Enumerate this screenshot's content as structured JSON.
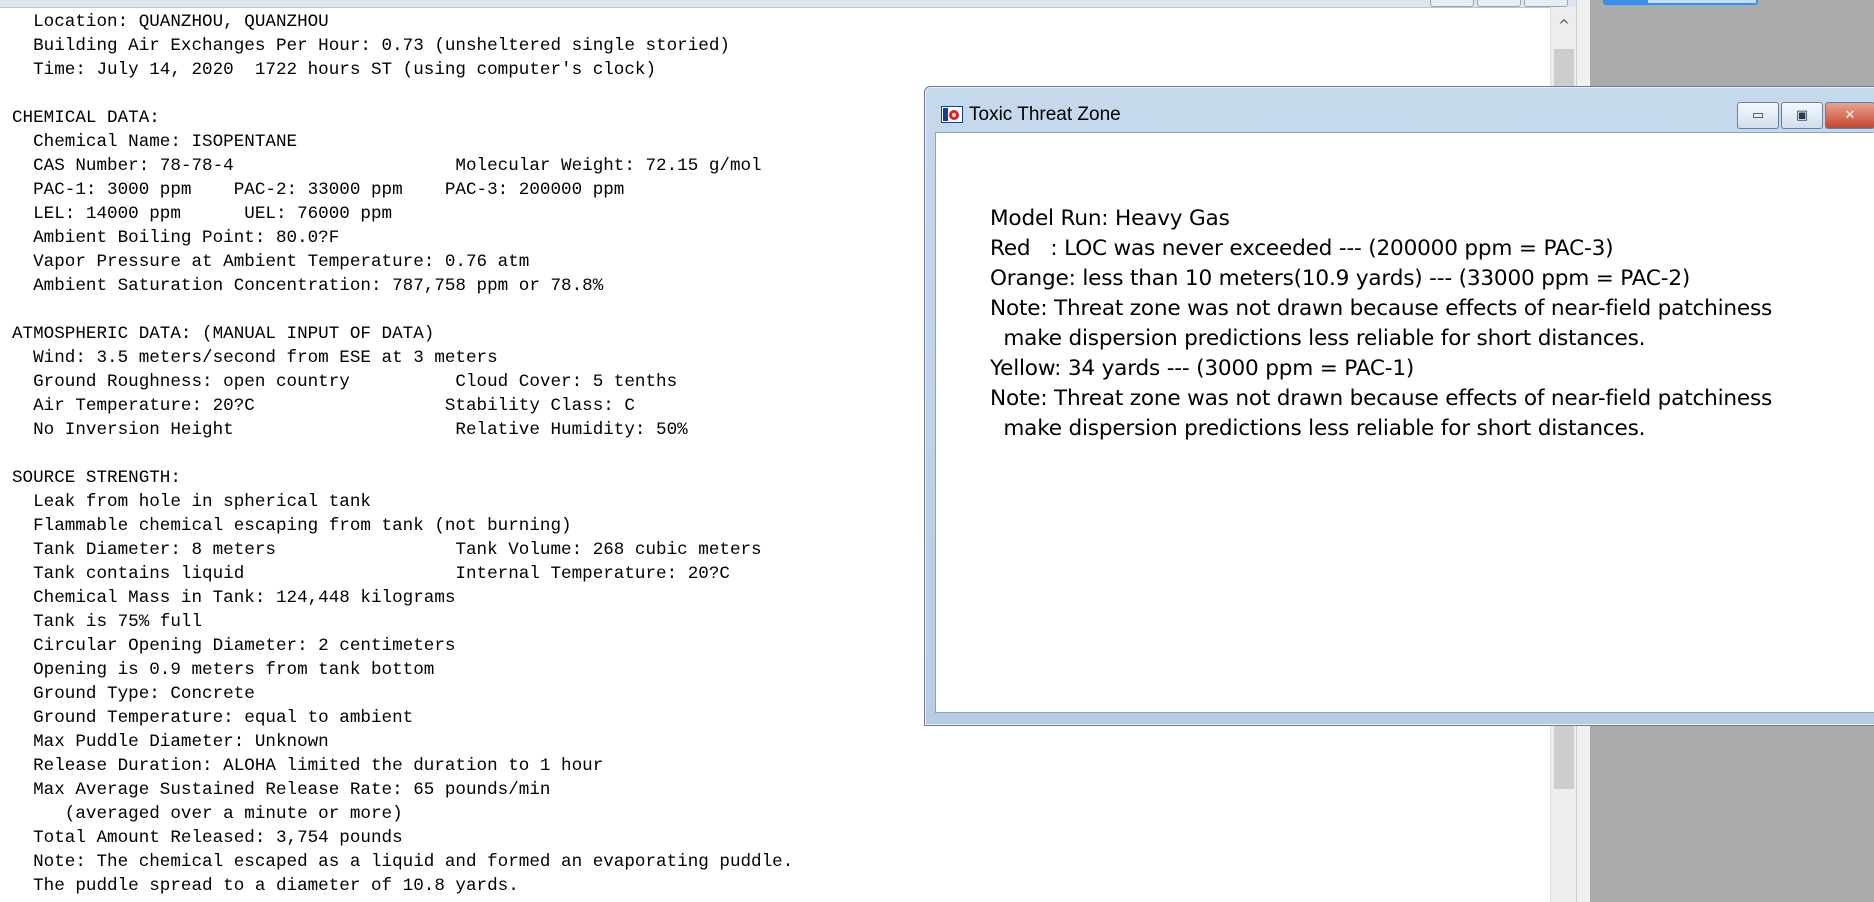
{
  "report": {
    "lines": [
      "  Location: QUANZHOU, QUANZHOU",
      "  Building Air Exchanges Per Hour: 0.73 (unsheltered single storied)",
      "  Time: July 14, 2020  1722 hours ST (using computer's clock)",
      "",
      "CHEMICAL DATA:",
      "  Chemical Name: ISOPENTANE",
      "  CAS Number: 78-78-4                     Molecular Weight: 72.15 g/mol",
      "  PAC-1: 3000 ppm    PAC-2: 33000 ppm    PAC-3: 200000 ppm",
      "  LEL: 14000 ppm      UEL: 76000 ppm",
      "  Ambient Boiling Point: 80.0?F",
      "  Vapor Pressure at Ambient Temperature: 0.76 atm",
      "  Ambient Saturation Concentration: 787,758 ppm or 78.8%",
      "",
      "ATMOSPHERIC DATA: (MANUAL INPUT OF DATA)",
      "  Wind: 3.5 meters/second from ESE at 3 meters",
      "  Ground Roughness: open country          Cloud Cover: 5 tenths",
      "  Air Temperature: 20?C                  Stability Class: C",
      "  No Inversion Height                     Relative Humidity: 50%",
      "",
      "SOURCE STRENGTH:",
      "  Leak from hole in spherical tank",
      "  Flammable chemical escaping from tank (not burning)",
      "  Tank Diameter: 8 meters                 Tank Volume: 268 cubic meters",
      "  Tank contains liquid                    Internal Temperature: 20?C",
      "  Chemical Mass in Tank: 124,448 kilograms",
      "  Tank is 75% full",
      "  Circular Opening Diameter: 2 centimeters",
      "  Opening is 0.9 meters from tank bottom",
      "  Ground Type: Concrete",
      "  Ground Temperature: equal to ambient",
      "  Max Puddle Diameter: Unknown",
      "  Release Duration: ALOHA limited the duration to 1 hour",
      "  Max Average Sustained Release Rate: 65 pounds/min",
      "     (averaged over a minute or more)",
      "  Total Amount Released: 3,754 pounds",
      "  Note: The chemical escaped as a liquid and formed an evaporating puddle.",
      "  The puddle spread to a diameter of 10.8 yards."
    ]
  },
  "dialog": {
    "title": "Toxic Threat Zone",
    "minimize_glyph": "▭",
    "maximize_glyph": "▣",
    "close_glyph": "✕",
    "lines": [
      "Model Run: Heavy Gas",
      "Red   : LOC was never exceeded --- (200000 ppm = PAC-3)",
      "Orange: less than 10 meters(10.9 yards) --- (33000 ppm = PAC-2)",
      "Note: Threat zone was not drawn because effects of near-field patchiness",
      "  make dispersion predictions less reliable for short distances.",
      "Yellow: 34 yards --- (3000 ppm = PAC-1)",
      "Note: Threat zone was not drawn because effects of near-field patchiness",
      "  make dispersion predictions less reliable for short distances."
    ]
  },
  "scrollbar": {
    "up_glyph": "^"
  },
  "colors": {
    "titlebar": "#c6d8ec",
    "close_button": "#c7452d",
    "taskbar_tab": "#3d8ee6"
  }
}
